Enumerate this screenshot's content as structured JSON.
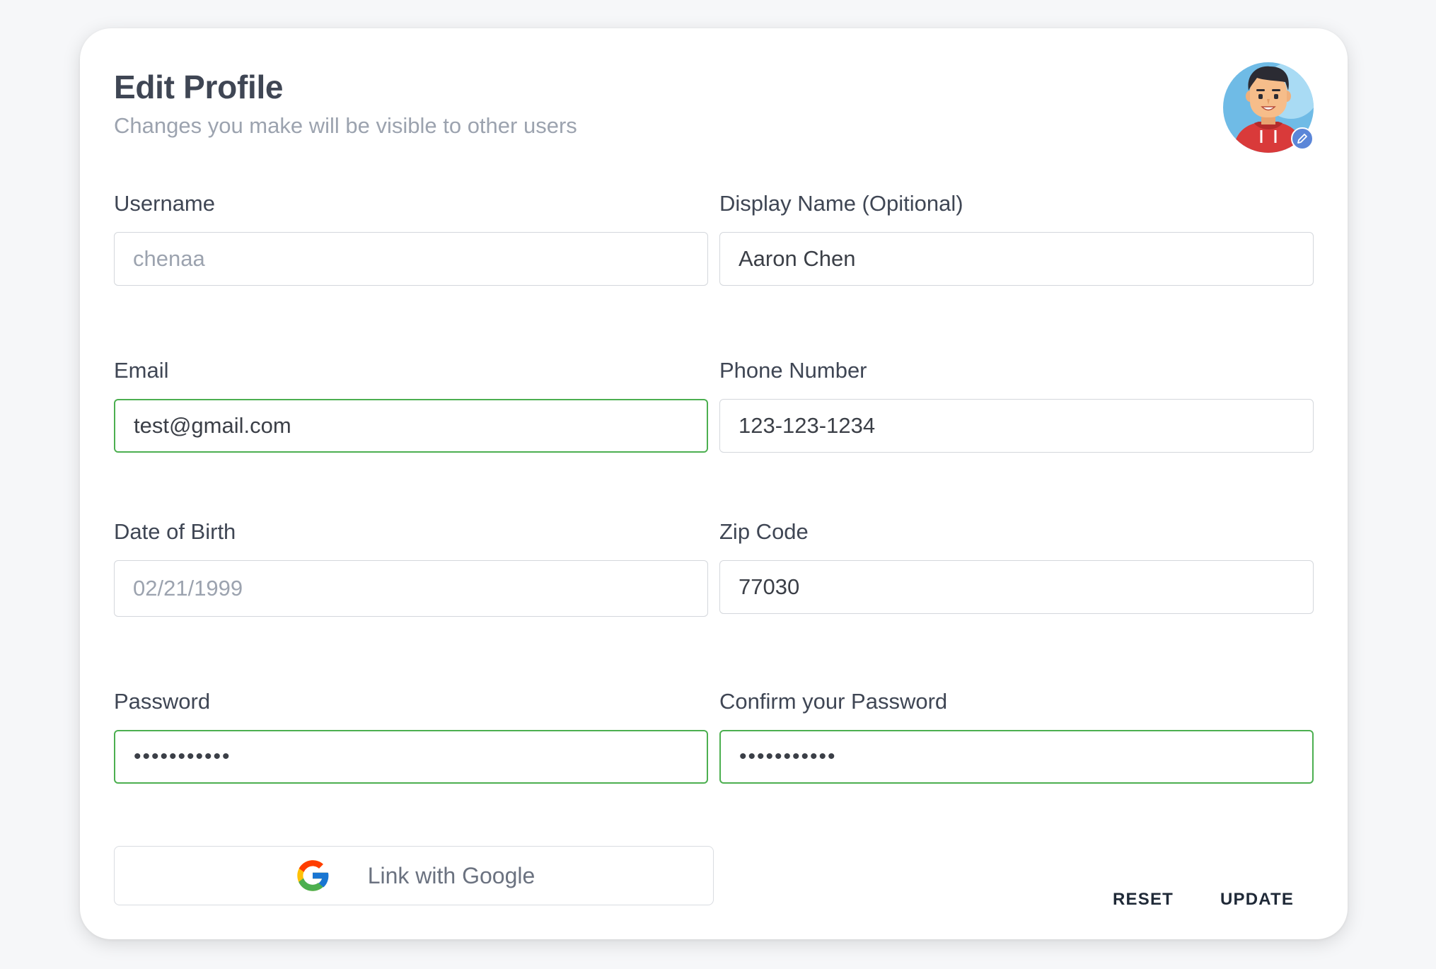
{
  "header": {
    "title": "Edit Profile",
    "subtitle": "Changes you make will be visible to other users"
  },
  "avatar": {
    "icon": "user-avatar",
    "edit_icon": "pencil-icon"
  },
  "fields": {
    "username": {
      "label": "Username",
      "value": "chenaa",
      "readonly": true
    },
    "display_name": {
      "label": "Display Name (Opitional)",
      "value": "Aaron Chen"
    },
    "email": {
      "label": "Email",
      "value": "test@gmail.com",
      "valid": true
    },
    "phone": {
      "label": "Phone Number",
      "value": "123-123-1234"
    },
    "dob": {
      "label": "Date of Birth",
      "value": "02/21/1999",
      "readonly": true
    },
    "zip": {
      "label": "Zip Code",
      "value": "77030"
    },
    "password": {
      "label": "Password",
      "masked": "•••••••••••",
      "valid": true
    },
    "confirm_password": {
      "label": "Confirm your Password",
      "masked": "•••••••••••",
      "valid": true
    }
  },
  "actions": {
    "google_label": "Link with Google",
    "google_icon": "google-g-icon",
    "reset_label": "RESET",
    "update_label": "UPDATE"
  },
  "colors": {
    "valid_border": "#4caf50",
    "title": "#3f4654",
    "muted": "#9ca3af"
  }
}
